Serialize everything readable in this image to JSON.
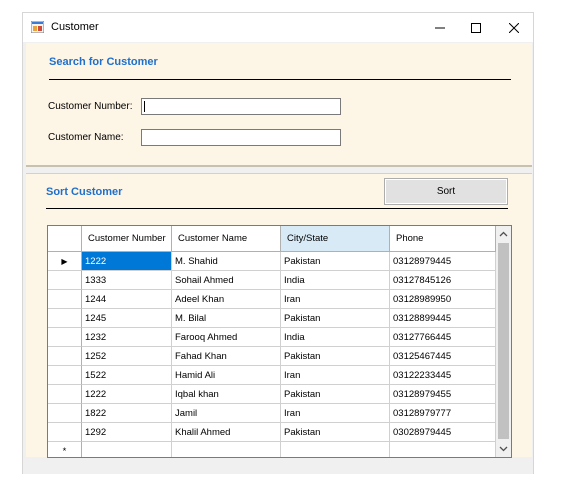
{
  "window": {
    "title": "Customer",
    "icon": "form-app-icon"
  },
  "search": {
    "title": "Search for Customer",
    "number_label": "Customer Number:",
    "number_value": "",
    "name_label": "Customer Name:",
    "name_value": ""
  },
  "sort": {
    "title": "Sort Customer",
    "button_label": "Sort"
  },
  "grid": {
    "columns": [
      "Customer Number",
      "Customer Name",
      "City/State",
      "Phone"
    ],
    "selected_column": "City/State",
    "selected_row": 0,
    "new_row_marker": "*",
    "current_row_marker": "▶",
    "rows": [
      [
        "1222",
        "M. Shahid",
        "Pakistan",
        "03128979445"
      ],
      [
        "1333",
        "Sohail Ahmed",
        "India",
        "03127845126"
      ],
      [
        "1244",
        "Adeel Khan",
        "Iran",
        "03128989950"
      ],
      [
        "1245",
        "M. Bilal",
        "Pakistan",
        "03128899445"
      ],
      [
        "1232",
        "Farooq Ahmed",
        "India",
        "03127766445"
      ],
      [
        "1252",
        "Fahad Khan",
        "Pakistan",
        "03125467445"
      ],
      [
        "1522",
        "Hamid Ali",
        "Iran",
        "03122233445"
      ],
      [
        "1222",
        "Iqbal khan",
        "Pakistan",
        "03128979455"
      ],
      [
        "1822",
        "Jamil",
        "Iran",
        "03128979777"
      ],
      [
        "1292",
        "Khalil Ahmed",
        "Pakistan",
        "03028979445"
      ]
    ]
  },
  "colors": {
    "accent_title": "#1f6fcb",
    "panel_bg": "#fdf5e6",
    "selection": "#0078d7",
    "selected_header": "#d9eaf7"
  }
}
